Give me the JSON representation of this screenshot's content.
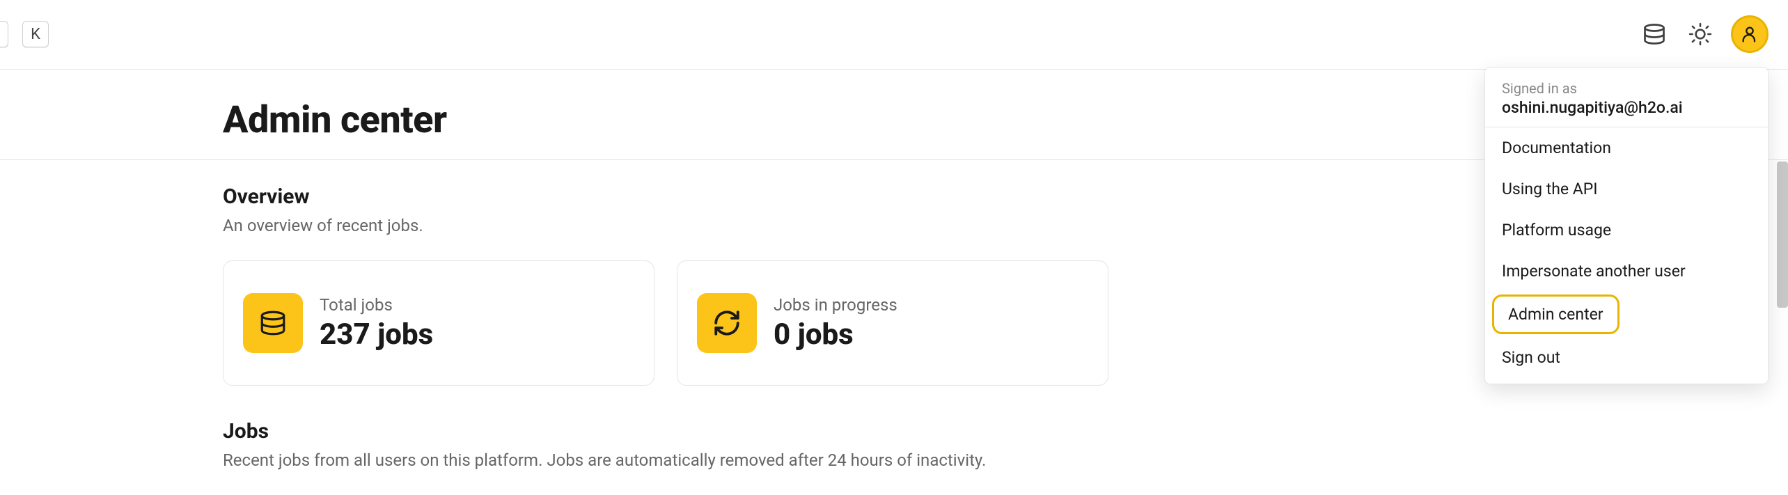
{
  "topbar": {
    "kbd_key": "K",
    "signed_in_label": "Signed in as",
    "user_email": "oshini.nugapitiya@h2o.ai",
    "menu_items": [
      "Documentation",
      "Using the API",
      "Platform usage",
      "Impersonate another user",
      "Admin center",
      "Sign out"
    ],
    "highlighted_menu_index": 4
  },
  "page": {
    "title": "Admin center"
  },
  "overview": {
    "heading": "Overview",
    "subheading": "An overview of recent jobs.",
    "cards": [
      {
        "label": "Total jobs",
        "value": "237 jobs",
        "icon": "database-icon"
      },
      {
        "label": "Jobs in progress",
        "value": "0 jobs",
        "icon": "refresh-icon"
      }
    ]
  },
  "jobs": {
    "heading": "Jobs",
    "subheading": "Recent jobs from all users on this platform. Jobs are automatically removed after 24 hours of inactivity."
  },
  "colors": {
    "accent": "#fcc419",
    "accent_border": "#e8b400",
    "text_muted": "#666666"
  }
}
